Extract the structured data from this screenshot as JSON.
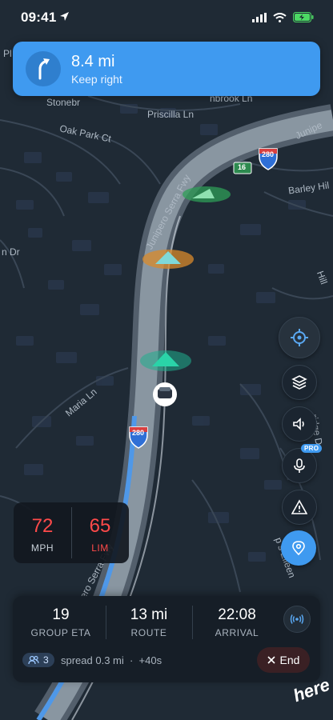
{
  "status_bar": {
    "time": "09:41"
  },
  "navigation": {
    "distance": "8.4 mi",
    "instruction": "Keep right"
  },
  "map_labels": {
    "oak_park_ct": "Oak Park Ct",
    "priscilla_ln": "Priscilla Ln",
    "stonebr": "Stonebr",
    "hbrook": "nbrook Ln",
    "junipero_top": "Junipe",
    "barley_hill": "Barley Hil",
    "junipero_serra": "Junipero Serra Fwy",
    "junipero_bottom": "pero Serra Fwy",
    "maria_ln": "Maria Ln",
    "n_dr": "n Dr",
    "hill": "Hill",
    "ridge": "ridge D",
    "ellee": "p s Elleen",
    "pl": "Pl",
    "interstate_280": "280",
    "route_16": "16"
  },
  "speed": {
    "current": "72",
    "current_unit": "MPH",
    "limit": "65",
    "limit_unit": "LIM"
  },
  "trip": {
    "group_eta_value": "19",
    "group_eta_label": "GROUP ETA",
    "route_value": "13 mi",
    "route_label": "ROUTE",
    "arrival_value": "22:08",
    "arrival_label": "ARRIVAL",
    "group_count": "3",
    "spread_text": "spread 0.3 mi  ·  +40s",
    "end_label": "End"
  },
  "controls": {
    "pro_badge": "PRO",
    "icons": [
      "crosshair-icon",
      "layers-icon",
      "speaker-icon",
      "microphone-icon",
      "alert-triangle-icon",
      "location-pin-icon",
      "broadcast-icon"
    ]
  },
  "brand": {
    "logo_text": "here"
  },
  "colors": {
    "accent": "#3f9af0",
    "speed_red": "#ff4a4a",
    "teal_marker": "#1fae8e",
    "orange_marker": "#d98a2b",
    "green_marker": "#2f9e57"
  }
}
